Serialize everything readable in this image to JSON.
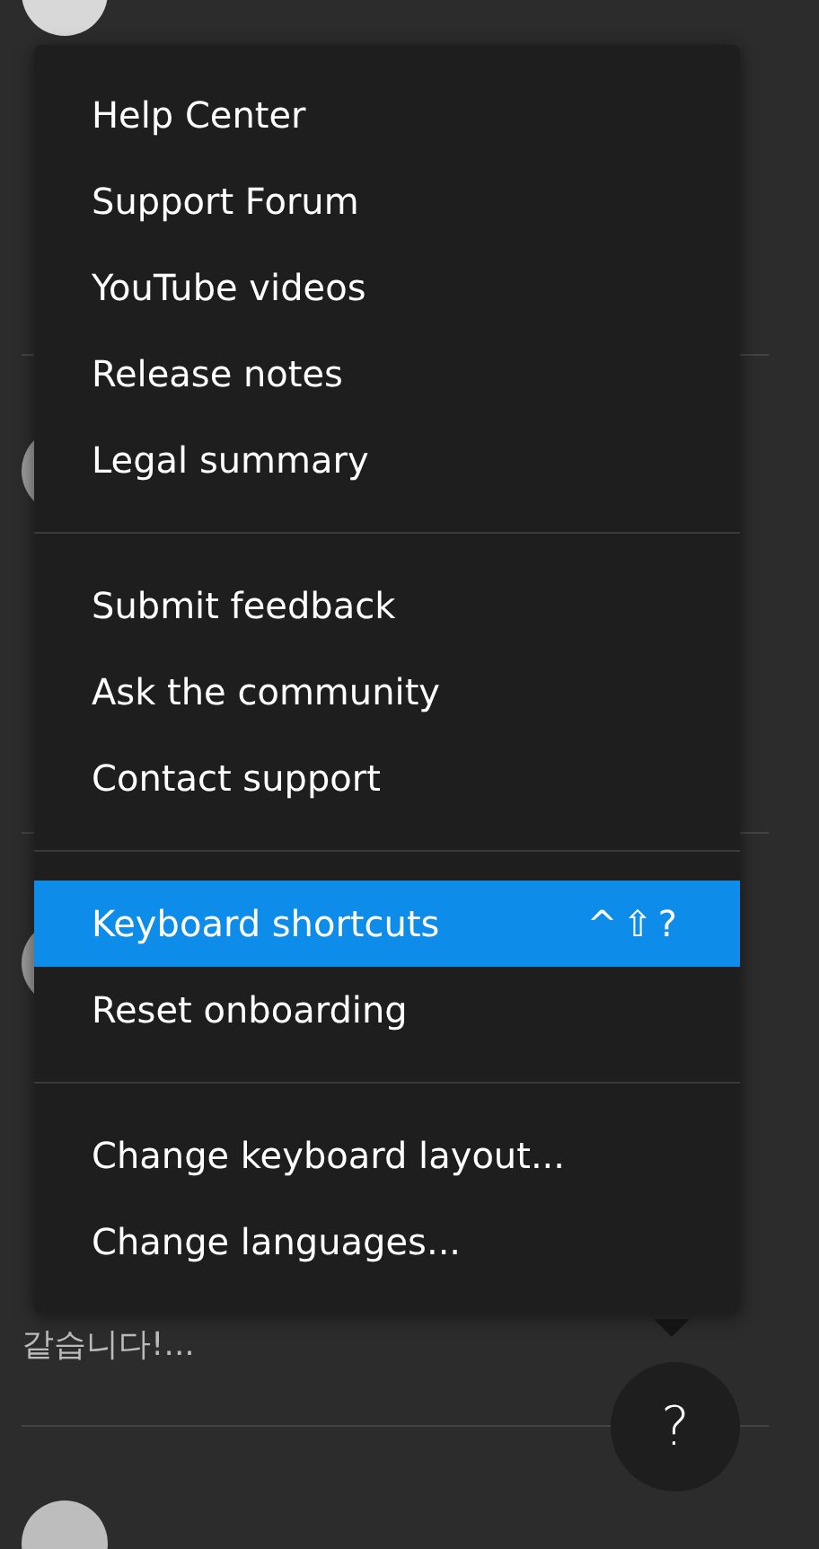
{
  "feed": {
    "snippet": "같습니다!..."
  },
  "menu": {
    "groups": [
      {
        "items": [
          {
            "label": "Help Center",
            "selected": false
          },
          {
            "label": "Support Forum",
            "selected": false
          },
          {
            "label": "YouTube videos",
            "selected": false
          },
          {
            "label": "Release notes",
            "selected": false
          },
          {
            "label": "Legal summary",
            "selected": false
          }
        ]
      },
      {
        "items": [
          {
            "label": "Submit feedback",
            "selected": false
          },
          {
            "label": "Ask the community",
            "selected": false
          },
          {
            "label": "Contact support",
            "selected": false
          }
        ]
      },
      {
        "items": [
          {
            "label": "Keyboard shortcuts",
            "selected": true,
            "shortcut": "^⇧?"
          },
          {
            "label": "Reset onboarding",
            "selected": false
          }
        ]
      },
      {
        "items": [
          {
            "label": "Change keyboard layout...",
            "selected": false
          },
          {
            "label": "Change languages...",
            "selected": false
          }
        ]
      }
    ]
  },
  "help_button": {
    "label": "?"
  }
}
